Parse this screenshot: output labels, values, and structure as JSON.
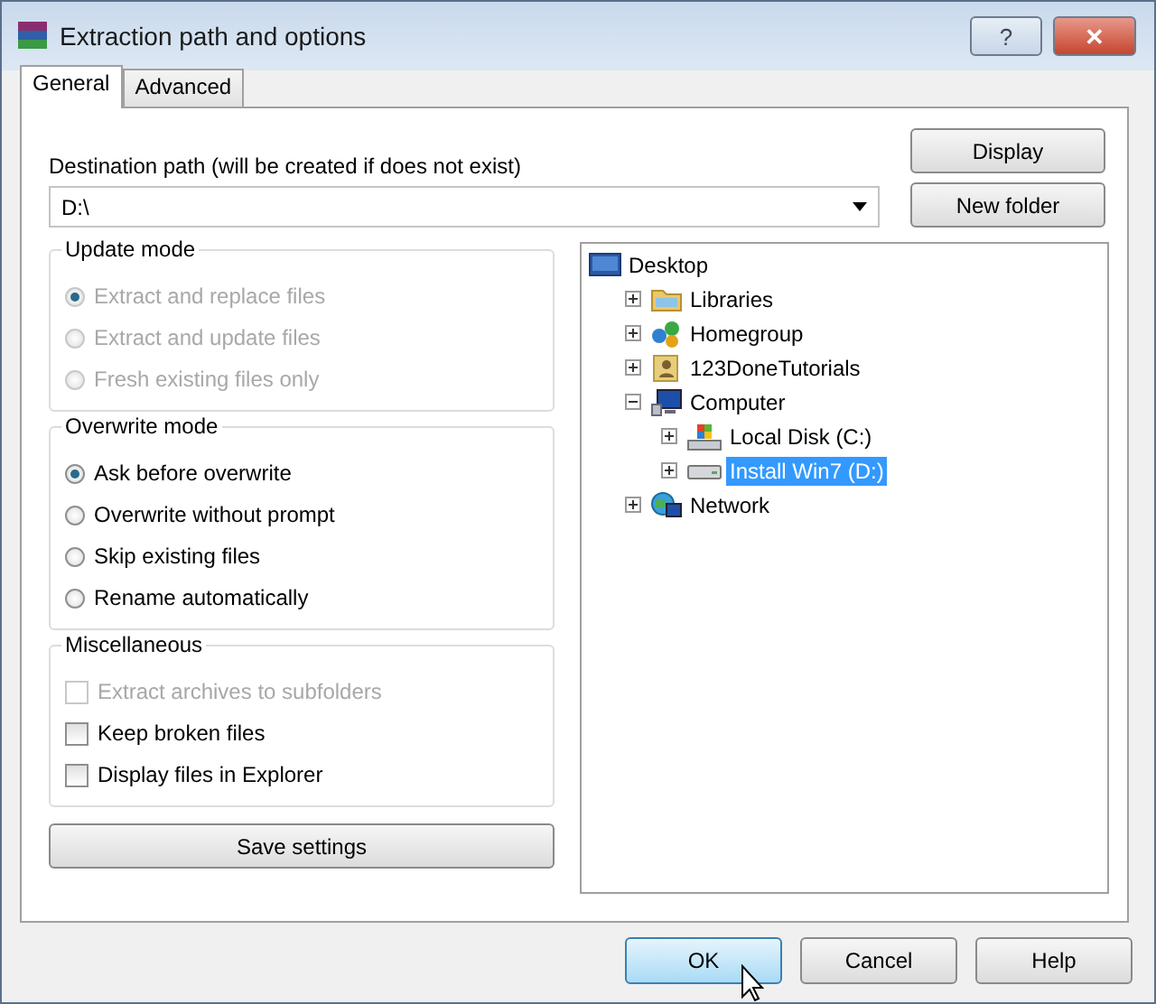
{
  "window": {
    "title": "Extraction path and options"
  },
  "title_buttons": [
    {
      "kind": "help",
      "label": "?"
    },
    {
      "kind": "close",
      "label": "✕"
    }
  ],
  "tabs": [
    {
      "label": "General",
      "selected": true
    },
    {
      "label": "Advanced",
      "selected": false
    }
  ],
  "destination": {
    "label": "Destination path (will be created if does not exist)",
    "value": "D:\\"
  },
  "side_buttons": [
    "Display",
    "New folder"
  ],
  "groups": [
    {
      "title": "Update mode",
      "kind": "radio",
      "options": [
        {
          "label": "Extract and replace files",
          "selected": true,
          "disabled": true
        },
        {
          "label": "Extract and update files",
          "selected": false,
          "disabled": true
        },
        {
          "label": "Fresh existing files only",
          "selected": false,
          "disabled": true
        }
      ]
    },
    {
      "title": "Overwrite mode",
      "kind": "radio",
      "options": [
        {
          "label": "Ask before overwrite",
          "selected": true,
          "disabled": false
        },
        {
          "label": "Overwrite without prompt",
          "selected": false,
          "disabled": false
        },
        {
          "label": "Skip existing files",
          "selected": false,
          "disabled": false
        },
        {
          "label": "Rename automatically",
          "selected": false,
          "disabled": false
        }
      ]
    },
    {
      "title": "Miscellaneous",
      "kind": "checkbox",
      "options": [
        {
          "label": "Extract archives to subfolders",
          "checked": false,
          "disabled": true
        },
        {
          "label": "Keep broken files",
          "checked": false,
          "disabled": false
        },
        {
          "label": "Display files in Explorer",
          "checked": false,
          "disabled": false
        }
      ]
    }
  ],
  "save_button": "Save settings",
  "tree": [
    {
      "label": "Desktop",
      "kind": "desktop",
      "selected": false,
      "children": [
        {
          "label": "Libraries",
          "kind": "library",
          "selected": false,
          "expanded": false
        },
        {
          "label": "Homegroup",
          "kind": "homegroup",
          "selected": false,
          "expanded": false
        },
        {
          "label": "123DoneTutorials",
          "kind": "user",
          "selected": false,
          "expanded": false
        },
        {
          "label": "Computer",
          "kind": "computer",
          "selected": false,
          "expanded": true,
          "children": [
            {
              "label": "Local Disk (C:)",
              "kind": "system-disk",
              "selected": false,
              "expanded": false
            },
            {
              "label": "Install Win7 (D:)",
              "kind": "drive",
              "selected": true,
              "expanded": false
            }
          ]
        },
        {
          "label": "Network",
          "kind": "network",
          "selected": false,
          "expanded": false
        }
      ]
    }
  ],
  "dialog_buttons": [
    {
      "label": "OK",
      "default": true
    },
    {
      "label": "Cancel",
      "default": false
    },
    {
      "label": "Help",
      "default": false
    }
  ]
}
